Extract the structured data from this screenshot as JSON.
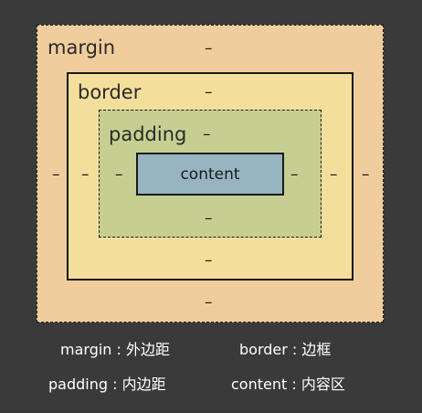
{
  "boxes": {
    "margin": {
      "label": "margin",
      "color": "#f0cd9c"
    },
    "border": {
      "label": "border",
      "color": "#f4de9c"
    },
    "padding": {
      "label": "padding",
      "color": "#c6cf91"
    },
    "content": {
      "label": "content",
      "color": "#97b4c1"
    }
  },
  "dash_symbol": "–",
  "legend": {
    "margin": "margin : 外边距",
    "border": "border : 边框",
    "padding": "padding : 内边距",
    "content": "content : 内容区"
  }
}
